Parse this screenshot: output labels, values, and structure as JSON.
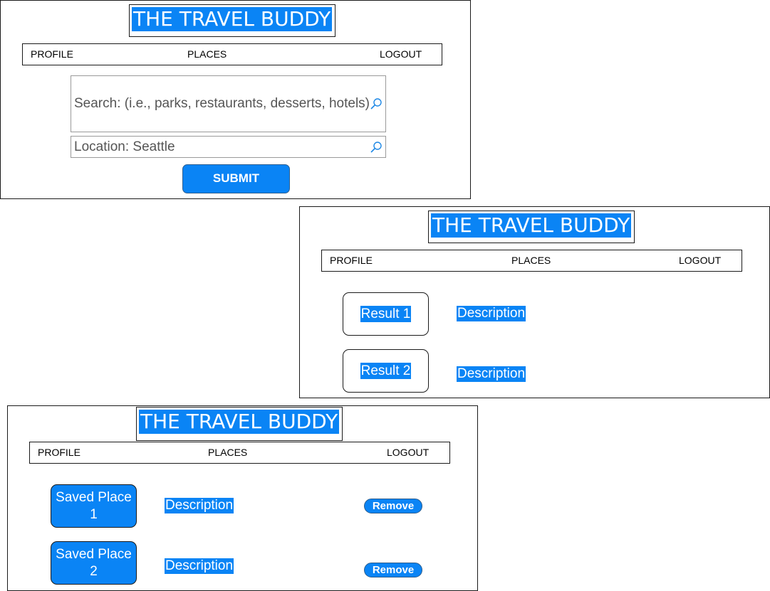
{
  "app_title": "THE TRAVEL BUDDY",
  "nav": {
    "profile": "PROFILE",
    "places": "PLACES",
    "logout": "LOGOUT"
  },
  "search_screen": {
    "search_placeholder": "Search: (i.e., parks, restaurants, desserts, hotels)",
    "location_value": "Location: Seattle",
    "submit_label": "SUBMIT"
  },
  "results_screen": {
    "results": [
      {
        "label": "Result 1",
        "description": "Description"
      },
      {
        "label": "Result 2",
        "description": "Description"
      }
    ]
  },
  "saved_screen": {
    "places": [
      {
        "label": "Saved Place 1",
        "description": "Description",
        "remove_label": "Remove"
      },
      {
        "label": "Saved Place 2",
        "description": "Description",
        "remove_label": "Remove"
      }
    ]
  },
  "colors": {
    "accent": "#0a84f5",
    "border": "#1a1a1a"
  },
  "icons": [
    "search-icon"
  ]
}
